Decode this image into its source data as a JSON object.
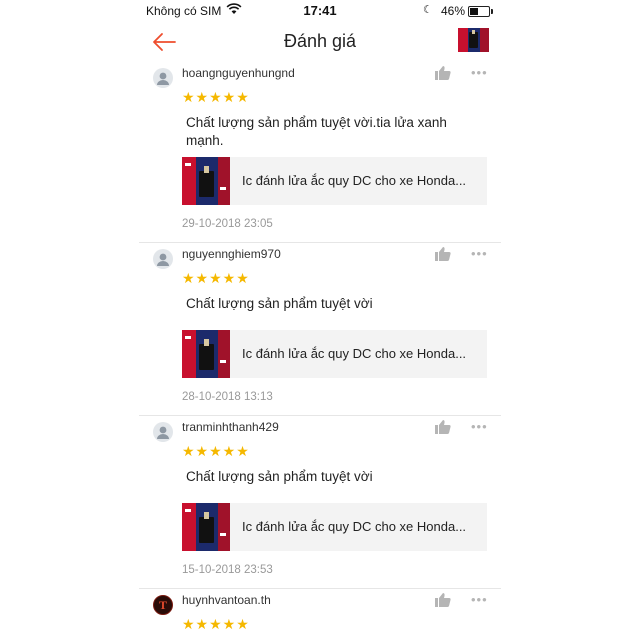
{
  "status_bar": {
    "carrier": "Không có SIM",
    "time": "17:41",
    "battery_percent": "46%",
    "battery_level": 0.46
  },
  "nav": {
    "back_icon": "arrow-left-icon",
    "title": "Đánh giá",
    "accent_color": "#ee4d2d"
  },
  "reviews": [
    {
      "username": "hoangnguyenhungnd",
      "rating": 5,
      "stars": "★★★★★",
      "comment": "Chất lượng sản phẩm tuyệt vời.tia lửa xanh mạnh.",
      "product_name": "Ic đánh lửa ắc quy DC cho xe Honda...",
      "date": "29-10-2018 23:05",
      "more": "•••"
    },
    {
      "username": "nguyennghiem970",
      "rating": 5,
      "stars": "★★★★★",
      "comment": "Chất lượng sản phẩm tuyệt vời",
      "product_name": "Ic đánh lửa ắc quy DC cho xe Honda...",
      "date": "28-10-2018 13:13",
      "more": "•••"
    },
    {
      "username": "tranminhthanh429",
      "rating": 5,
      "stars": "★★★★★",
      "comment": "Chất lượng sản phẩm tuyệt vời",
      "product_name": "Ic đánh lửa ắc quy DC cho xe Honda...",
      "date": "15-10-2018 23:53",
      "more": "•••"
    },
    {
      "username": "huynhvantoan.th",
      "rating": 5,
      "stars": "★★★★★",
      "more": "•••"
    }
  ],
  "colors": {
    "star": "#f5b800",
    "date_text": "#999999",
    "product_card_bg": "#f3f3f3"
  }
}
